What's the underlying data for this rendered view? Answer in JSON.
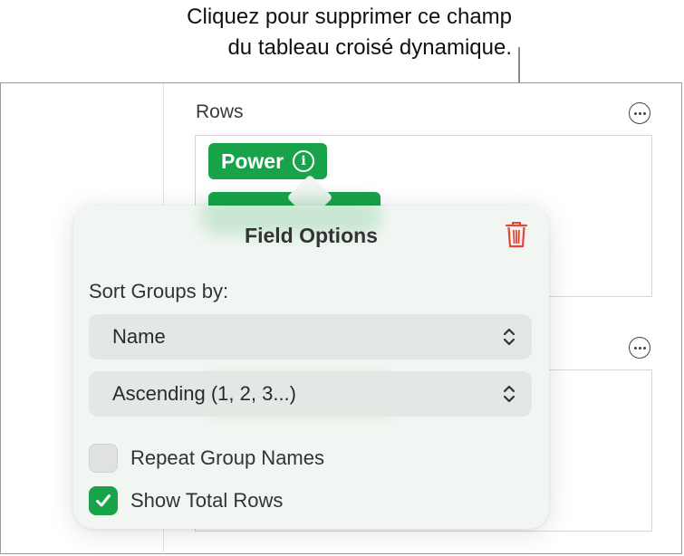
{
  "callout": {
    "line1": "Cliquez pour supprimer ce champ",
    "line2": "du tableau croisé dynamique."
  },
  "rows_section": {
    "label": "Rows",
    "fields": [
      {
        "label": "Power"
      }
    ]
  },
  "popover": {
    "title": "Field Options",
    "sort_label": "Sort Groups by:",
    "sort_by": {
      "selected": "Name"
    },
    "sort_order": {
      "selected": "Ascending (1, 2, 3...)"
    },
    "checkboxes": [
      {
        "label": "Repeat Group Names",
        "checked": false
      },
      {
        "label": "Show Total Rows",
        "checked": true
      }
    ]
  },
  "colors": {
    "accent_green": "#18a34a",
    "delete_red": "#e5443a"
  },
  "icons": [
    "info-icon",
    "more-options-icon",
    "trash-icon",
    "chevron-updown-icon",
    "checkmark-icon"
  ]
}
